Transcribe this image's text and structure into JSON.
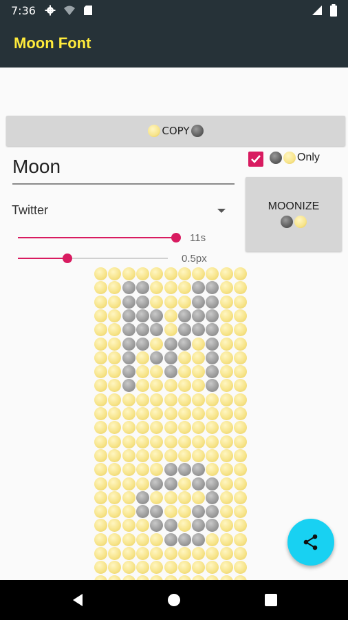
{
  "status_bar": {
    "time": "7:36",
    "icons": [
      "settings-icon",
      "wifi-icon",
      "sim-icon",
      "signal-icon",
      "battery-icon"
    ]
  },
  "app_bar": {
    "title": "Moon Font",
    "title_color": "#ffeb3b",
    "background": "#263238"
  },
  "copy_button": {
    "label": "COPY",
    "emoji_left": "slightly-smiling-face-icon",
    "emoji_right": "new-moon-face-icon"
  },
  "text_input": {
    "value": "Moon"
  },
  "only_checkbox": {
    "checked": true,
    "label": "Only",
    "icons": [
      "new-moon-icon",
      "full-moon-icon"
    ]
  },
  "font_selector": {
    "selected": "Twitter"
  },
  "moonize_button": {
    "label": "MOONIZE",
    "icons": [
      "new-moon-icon",
      "full-moon-icon"
    ]
  },
  "size_slider": {
    "value_label": "11s",
    "value": 1.0
  },
  "spacing_slider": {
    "value_label": "0.5px",
    "value": 0.33
  },
  "moon_grid": {
    "columns": 11,
    "rows": [
      "FFFFFFFFFFF",
      "FFNNFFFNNFF",
      "FFNNFFFNNFF",
      "FFNNNFNNNFF",
      "FFNNNFNNNFF",
      "FFNNFNNFNFF",
      "FFNFNNFFNFF",
      "FFNFFNFFNFF",
      "FFNFFFFFNFF",
      "FFFFFFFFFFF",
      "FFFFFFFFFFF",
      "FFFFFFFFFFF",
      "FFFFFFFFFFF",
      "FFFFFFFFFFF",
      "FFFFFNNNFFF",
      "FFFFNNFNNFF",
      "FFFNFFFFNFF",
      "FFFNNFFNNFF",
      "FFFFNNFNNFF",
      "FFFFFNNNFFF",
      "FFFFFFFFFFF",
      "FFFFFFFFFFF",
      "FFFFFFFFFFF"
    ]
  },
  "share_button": {
    "icon": "share-icon",
    "color": "#18d1f2"
  },
  "accent_color": "#d81b60",
  "nav_bar": {
    "icons": [
      "back-icon",
      "home-icon",
      "recents-icon"
    ]
  }
}
